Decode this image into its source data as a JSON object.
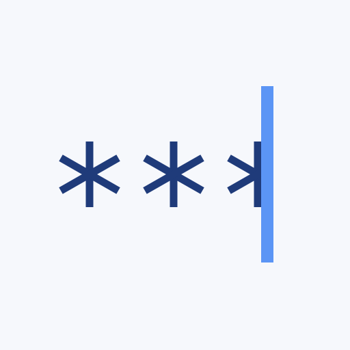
{
  "password_field": {
    "masked_character_count": 3,
    "mask_glyph": "asterisk",
    "caret_visible": true,
    "colors": {
      "background": "#f6f8fc",
      "mask": "#1f3b7a",
      "caret": "#5b95f5"
    }
  }
}
